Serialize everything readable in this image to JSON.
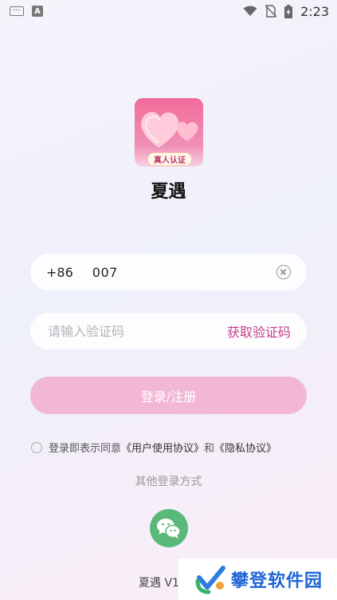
{
  "status_bar": {
    "time": "2:23"
  },
  "app": {
    "name": "夏遇",
    "badge": "真人认证"
  },
  "phone": {
    "country_code": "+86",
    "value": "007"
  },
  "code": {
    "placeholder": "请输入验证码",
    "get_code_label": "获取验证码"
  },
  "login_button": "登录/注册",
  "agreement": {
    "prefix": "登录即表示同意",
    "user_agreement": "《用户使用协议》",
    "and": "和",
    "privacy": "《隐私协议》"
  },
  "other_login_title": "其他登录方式",
  "version": "夏遇 V1",
  "watermark": "攀登软件园",
  "colors": {
    "accent": "#c2418d",
    "button": "#f2b7d6",
    "wechat": "#5ab97a"
  }
}
